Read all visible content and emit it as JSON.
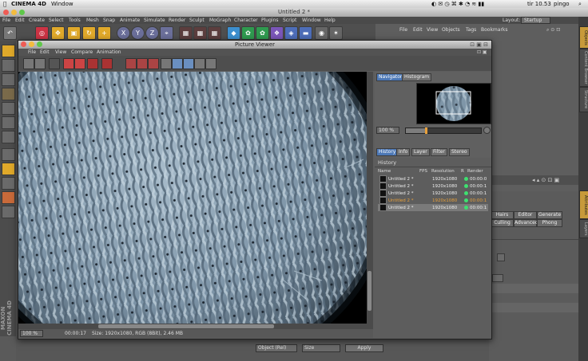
{
  "mac_menubar": {
    "app_name": "CINEMA 4D",
    "window_menu": "Window",
    "clock": "tir 10.53",
    "user": "pingo"
  },
  "c4d": {
    "document_title": "Untitled 2 *",
    "menu": [
      "File",
      "Edit",
      "Create",
      "Select",
      "Tools",
      "Mesh",
      "Snap",
      "Animate",
      "Simulate",
      "Render",
      "Sculpt",
      "MoGraph",
      "Character",
      "Plugins",
      "Script",
      "Window",
      "Help"
    ],
    "layout_label": "Layout:",
    "layout_value": "Startup",
    "object_manager_menu": [
      "File",
      "Edit",
      "View",
      "Objects",
      "Tags",
      "Bookmarks"
    ],
    "axis_buttons": [
      "X",
      "Y",
      "Z"
    ],
    "attribute_buttons": [
      "Hairs",
      "Editor",
      "Generate",
      "Culling",
      "Advanced",
      "Phong"
    ],
    "bottom": {
      "object_mode": "Object (Rel)",
      "size_mode": "Size",
      "apply": "Apply"
    },
    "right_tabs": [
      "Objects",
      "Content Browser",
      "Structure",
      "Attributes",
      "Layers"
    ],
    "logo_text": "MAXON CINEMA 4D"
  },
  "picture_viewer": {
    "title": "Picture Viewer",
    "menu": [
      "File",
      "Edit",
      "View",
      "Compare",
      "Animation"
    ],
    "tabs_top": [
      "Navigator",
      "Histogram"
    ],
    "zoom_value": "100 %",
    "tabs_mid": [
      "History",
      "Info",
      "Layer",
      "Filter",
      "Stereo"
    ],
    "history_heading": "History",
    "history_columns": [
      "Name",
      "FPS",
      "Resolution",
      "R",
      "Render"
    ],
    "history_rows": [
      {
        "name": "Untitled 2 *",
        "resolution": "1920x1080",
        "render": "00:00:0",
        "highlight": false,
        "selected": false
      },
      {
        "name": "Untitled 2 *",
        "resolution": "1920x1080",
        "render": "00:00:1",
        "highlight": false,
        "selected": false
      },
      {
        "name": "Untitled 2 *",
        "resolution": "1920x1080",
        "render": "00:00:1",
        "highlight": false,
        "selected": false
      },
      {
        "name": "Untitled 2 *",
        "resolution": "1920x1080",
        "render": "00:00:1",
        "highlight": true,
        "selected": false
      },
      {
        "name": "Untitled 2 *",
        "resolution": "1920x1080",
        "render": "00:00:1",
        "highlight": false,
        "selected": true
      }
    ],
    "status": {
      "zoom": "100 %",
      "time": "00:00:17",
      "size_info": "Size: 1920x1080, RGB (8Bit), 2.46 MB"
    }
  },
  "colors": {
    "accent_tab": "#4c78b6",
    "highlight_row": "#e8a03a",
    "render_ok_dot": "#3ee070",
    "yarn": "#9db3c4"
  }
}
